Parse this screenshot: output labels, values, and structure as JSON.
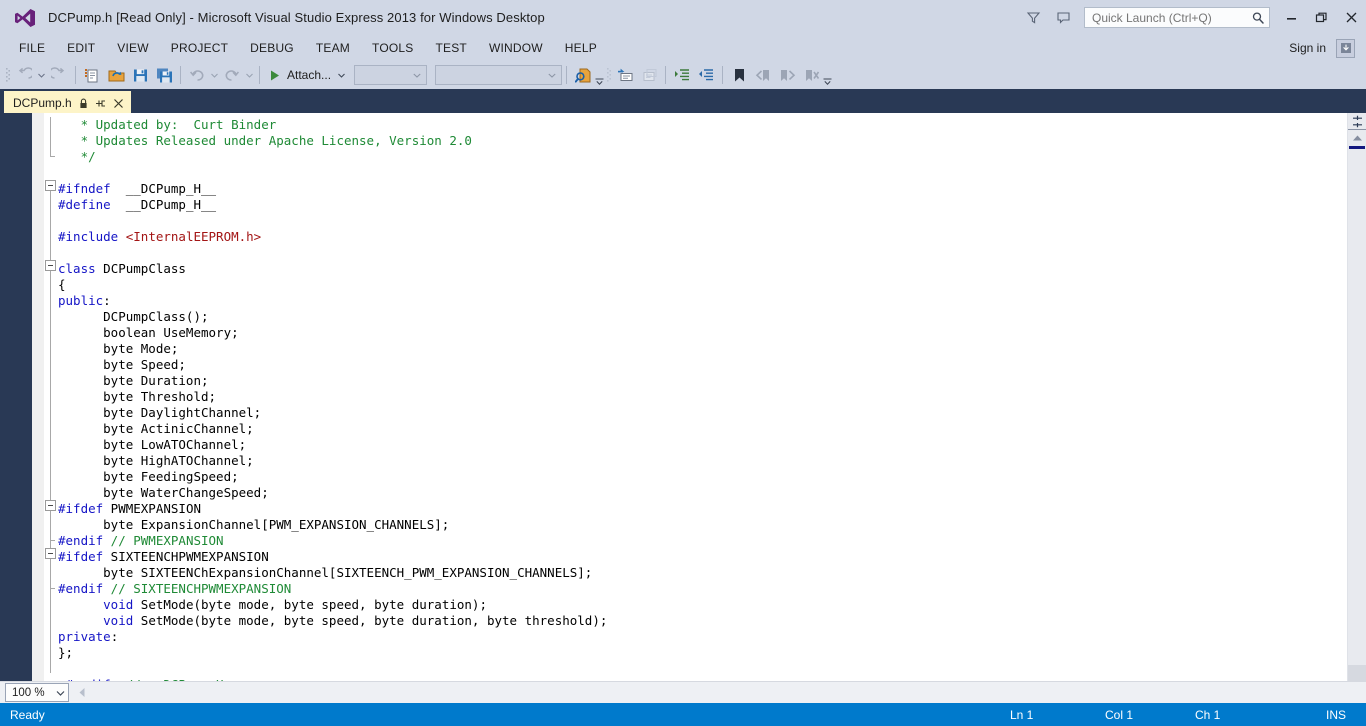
{
  "window": {
    "title": "DCPump.h [Read Only] - Microsoft Visual Studio Express 2013 for Windows Desktop",
    "logo_icon": "visual-studio-logo-icon",
    "minimize_icon": "minimize-icon",
    "restore_icon": "restore-icon",
    "close_icon": "close-icon",
    "feedback_icon": "feedback-icon",
    "filter_icon": "filter-icon"
  },
  "quick_launch": {
    "placeholder": "Quick Launch (Ctrl+Q)",
    "value": "",
    "search_icon": "search-icon"
  },
  "menu": {
    "items": [
      {
        "label": "FILE"
      },
      {
        "label": "EDIT"
      },
      {
        "label": "VIEW"
      },
      {
        "label": "PROJECT"
      },
      {
        "label": "DEBUG"
      },
      {
        "label": "TEAM"
      },
      {
        "label": "TOOLS"
      },
      {
        "label": "TEST"
      },
      {
        "label": "WINDOW"
      },
      {
        "label": "HELP"
      }
    ],
    "sign_in": "Sign in",
    "notification_icon": "notification-icon"
  },
  "toolbar": {
    "navigate_back_icon": "navigate-back-icon",
    "navigate_forward_icon": "navigate-forward-icon",
    "new_item_icon": "new-item-icon",
    "open_file_icon": "open-file-icon",
    "save_icon": "save-icon",
    "save_all_icon": "save-all-icon",
    "undo_icon": "undo-icon",
    "redo_icon": "redo-icon",
    "attach_label": "Attach...",
    "attach_play_icon": "play-icon",
    "combo1_value": "",
    "combo2_value": "",
    "find_icon": "find-in-files-icon",
    "comment_icon": "comment-selection-icon",
    "uncomment_icon": "uncomment-selection-icon",
    "indent_icon": "increase-indent-icon",
    "outdent_icon": "decrease-indent-icon",
    "bookmark_icon": "toggle-bookmark-icon",
    "prev_bookmark_icon": "previous-bookmark-icon",
    "next_bookmark_icon": "next-bookmark-icon",
    "clear_bookmarks_icon": "clear-bookmarks-icon",
    "overflow_icon": "toolbar-overflow-icon"
  },
  "tab": {
    "label": "DCPump.h",
    "lock_icon": "read-only-lock-icon",
    "pin_icon": "pin-icon",
    "close_icon": "close-tab-icon"
  },
  "editor": {
    "zoom_value": "100 %",
    "zoom_caret_icon": "chevron-down-icon",
    "split_icon": "split-editor-icon",
    "scroll_up_icon": "scroll-up-arrow-icon",
    "scroll_left_icon": "scroll-left-arrow-icon",
    "lines": [
      {
        "indent": 3,
        "segments": [
          {
            "cls": "c-com",
            "t": "* Updated by:  Curt Binder"
          }
        ]
      },
      {
        "indent": 3,
        "segments": [
          {
            "cls": "c-com",
            "t": "* Updates Released under Apache License, Version 2.0"
          }
        ]
      },
      {
        "indent": 3,
        "segments": [
          {
            "cls": "c-com",
            "t": "*/"
          }
        ]
      },
      {
        "indent": 0,
        "segments": []
      },
      {
        "indent": 0,
        "segments": [
          {
            "cls": "c-pp",
            "t": "#ifndef"
          },
          {
            "cls": "c-txt",
            "t": "  __DCPump_H__"
          }
        ]
      },
      {
        "indent": 0,
        "segments": [
          {
            "cls": "c-pp",
            "t": "#define"
          },
          {
            "cls": "c-txt",
            "t": "  __DCPump_H__"
          }
        ]
      },
      {
        "indent": 0,
        "segments": []
      },
      {
        "indent": 0,
        "segments": [
          {
            "cls": "c-pp",
            "t": "#include"
          },
          {
            "cls": "c-str",
            "t": " <InternalEEPROM.h>"
          }
        ]
      },
      {
        "indent": 0,
        "segments": []
      },
      {
        "indent": 0,
        "segments": [
          {
            "cls": "c-kw",
            "t": "class"
          },
          {
            "cls": "c-txt",
            "t": " DCPumpClass"
          }
        ]
      },
      {
        "indent": 0,
        "segments": [
          {
            "cls": "c-txt",
            "t": "{"
          }
        ]
      },
      {
        "indent": 0,
        "segments": [
          {
            "cls": "c-kw",
            "t": "public"
          },
          {
            "cls": "c-txt",
            "t": ":"
          }
        ]
      },
      {
        "indent": 0,
        "segments": [
          {
            "cls": "c-txt",
            "t": "      DCPumpClass();"
          }
        ]
      },
      {
        "indent": 0,
        "segments": [
          {
            "cls": "c-txt",
            "t": "      boolean UseMemory;"
          }
        ]
      },
      {
        "indent": 0,
        "segments": [
          {
            "cls": "c-txt",
            "t": "      byte Mode;"
          }
        ]
      },
      {
        "indent": 0,
        "segments": [
          {
            "cls": "c-txt",
            "t": "      byte Speed;"
          }
        ]
      },
      {
        "indent": 0,
        "segments": [
          {
            "cls": "c-txt",
            "t": "      byte Duration;"
          }
        ]
      },
      {
        "indent": 0,
        "segments": [
          {
            "cls": "c-txt",
            "t": "      byte Threshold;"
          }
        ]
      },
      {
        "indent": 0,
        "segments": [
          {
            "cls": "c-txt",
            "t": "      byte DaylightChannel;"
          }
        ]
      },
      {
        "indent": 0,
        "segments": [
          {
            "cls": "c-txt",
            "t": "      byte ActinicChannel;"
          }
        ]
      },
      {
        "indent": 0,
        "segments": [
          {
            "cls": "c-txt",
            "t": "      byte LowATOChannel;"
          }
        ]
      },
      {
        "indent": 0,
        "segments": [
          {
            "cls": "c-txt",
            "t": "      byte HighATOChannel;"
          }
        ]
      },
      {
        "indent": 0,
        "segments": [
          {
            "cls": "c-txt",
            "t": "      byte FeedingSpeed;"
          }
        ]
      },
      {
        "indent": 0,
        "segments": [
          {
            "cls": "c-txt",
            "t": "      byte WaterChangeSpeed;"
          }
        ]
      },
      {
        "indent": 0,
        "segments": [
          {
            "cls": "c-pp",
            "t": "#ifdef"
          },
          {
            "cls": "c-txt",
            "t": " PWMEXPANSION"
          }
        ]
      },
      {
        "indent": 0,
        "segments": [
          {
            "cls": "c-txt",
            "t": "      byte ExpansionChannel[PWM_EXPANSION_CHANNELS];"
          }
        ]
      },
      {
        "indent": 0,
        "segments": [
          {
            "cls": "c-pp",
            "t": "#endif"
          },
          {
            "cls": "c-com",
            "t": " // PWMEXPANSION"
          }
        ]
      },
      {
        "indent": 0,
        "segments": [
          {
            "cls": "c-pp",
            "t": "#ifdef"
          },
          {
            "cls": "c-txt",
            "t": " SIXTEENCHPWMEXPANSION"
          }
        ]
      },
      {
        "indent": 0,
        "segments": [
          {
            "cls": "c-txt",
            "t": "      byte SIXTEENChExpansionChannel[SIXTEENCH_PWM_EXPANSION_CHANNELS];"
          }
        ]
      },
      {
        "indent": 0,
        "segments": [
          {
            "cls": "c-pp",
            "t": "#endif"
          },
          {
            "cls": "c-com",
            "t": " // SIXTEENCHPWMEXPANSION"
          }
        ]
      },
      {
        "indent": 0,
        "segments": [
          {
            "cls": "c-txt",
            "t": "      "
          },
          {
            "cls": "c-kw",
            "t": "void"
          },
          {
            "cls": "c-txt",
            "t": " SetMode(byte mode, byte speed, byte duration);"
          }
        ]
      },
      {
        "indent": 0,
        "segments": [
          {
            "cls": "c-txt",
            "t": "      "
          },
          {
            "cls": "c-kw",
            "t": "void"
          },
          {
            "cls": "c-txt",
            "t": " SetMode(byte mode, byte speed, byte duration, byte threshold);"
          }
        ]
      },
      {
        "indent": 0,
        "segments": [
          {
            "cls": "c-kw",
            "t": "private"
          },
          {
            "cls": "c-txt",
            "t": ":"
          }
        ]
      },
      {
        "indent": 0,
        "segments": [
          {
            "cls": "c-txt",
            "t": "};"
          }
        ]
      },
      {
        "indent": 0,
        "segments": []
      },
      {
        "indent": 1,
        "segments": [
          {
            "cls": "c-pp",
            "t": "#endif"
          },
          {
            "cls": "c-com",
            "t": "  // __DCPump_H__"
          }
        ]
      }
    ]
  },
  "statusbar": {
    "ready": "Ready",
    "line": "Ln 1",
    "column": "Col 1",
    "character": "Ch 1",
    "insert_mode": "INS"
  }
}
